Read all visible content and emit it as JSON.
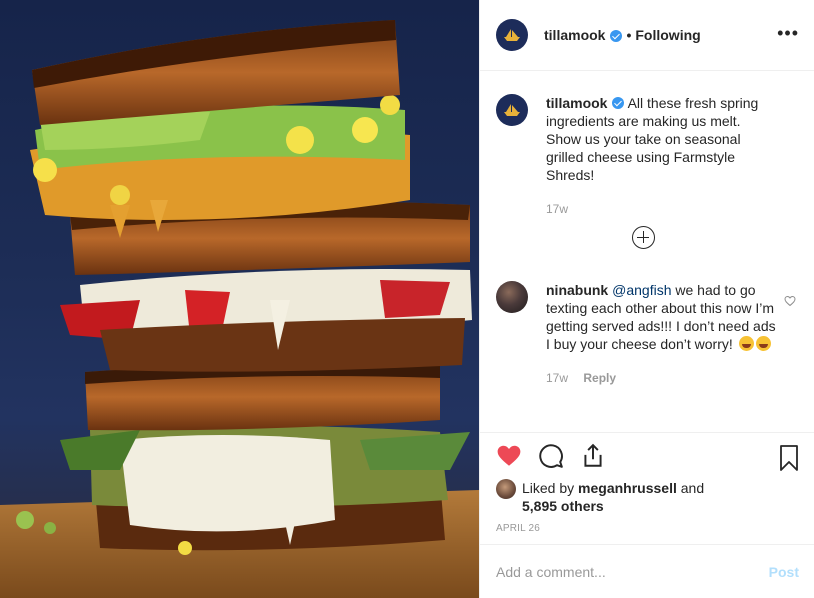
{
  "post": {
    "photo_alt": "",
    "header": {
      "username": "tillamook",
      "separator": "•",
      "follow_status": "Following",
      "more_label": "•••"
    },
    "caption": {
      "username": "tillamook",
      "text": "All these fresh spring ingredients are making us melt. Show us your take on seasonal grilled cheese using Farmstyle Shreds!",
      "time": "17w"
    },
    "comments": [
      {
        "username": "ninabunk",
        "mention": "@angfish",
        "text": "we had to go texting each other about this now I’m getting served ads!!! I don’t need ads I buy your cheese don’t worry!",
        "time": "17w",
        "reply_label": "Reply"
      }
    ],
    "likes": {
      "prefix": "Liked by",
      "user": "meganhrussell",
      "middle": "and",
      "others": "5,895 others"
    },
    "date": "APRIL 26",
    "add_comment": {
      "placeholder": "Add a comment...",
      "post_label": "Post"
    }
  },
  "colors": {
    "accent_blue": "#3897f0",
    "like_red": "#ed4956",
    "brand_navy": "#1d2c5a"
  },
  "icons": [
    "verified-badge-icon",
    "more-icon",
    "load-more-icon",
    "heart-icon",
    "comment-icon",
    "share-icon",
    "bookmark-icon"
  ]
}
